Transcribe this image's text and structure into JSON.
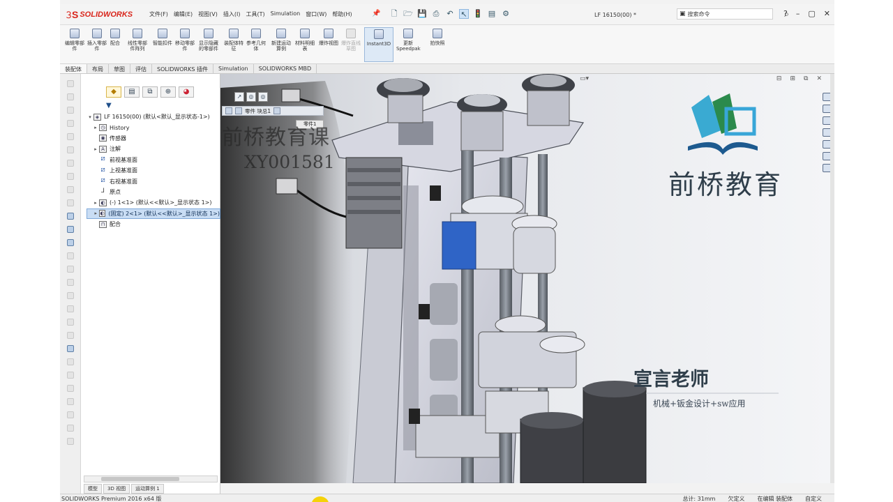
{
  "app": {
    "brand_logo": "SOLIDWORKS",
    "document_title": "LF 16150(00) *",
    "menus": [
      "文件(F)",
      "编辑(E)",
      "视图(V)",
      "插入(I)",
      "工具(T)",
      "Simulation",
      "窗口(W)",
      "帮助(H)"
    ],
    "search_placeholder": "搜索命令",
    "window_buttons": [
      "?",
      "–",
      "▢",
      "✕"
    ]
  },
  "commands": [
    {
      "label": "编辑零部件",
      "icon": "edit-component-icon",
      "state": "enabled"
    },
    {
      "label": "插入零部件",
      "icon": "insert-components-icon",
      "state": "enabled"
    },
    {
      "label": "配合",
      "icon": "mate-icon",
      "state": "enabled"
    },
    {
      "label": "线性零部件阵列",
      "icon": "linear-pattern-icon",
      "state": "enabled"
    },
    {
      "label": "智能扣件",
      "icon": "smart-fasteners-icon",
      "state": "enabled"
    },
    {
      "label": "移动零部件",
      "icon": "move-component-icon",
      "state": "enabled"
    },
    {
      "label": "显示隐藏的零部件",
      "icon": "show-hidden-icon",
      "state": "enabled"
    },
    {
      "label": "装配体特征",
      "icon": "assembly-features-icon",
      "state": "enabled"
    },
    {
      "label": "参考几何体",
      "icon": "reference-geometry-icon",
      "state": "enabled"
    },
    {
      "label": "新建运动算例",
      "icon": "motion-study-icon",
      "state": "enabled"
    },
    {
      "label": "材料明细表",
      "icon": "bom-icon",
      "state": "enabled"
    },
    {
      "label": "爆炸视图",
      "icon": "exploded-view-icon",
      "state": "enabled"
    },
    {
      "label": "爆炸直线草图",
      "icon": "explode-line-sketch-icon",
      "state": "disabled"
    },
    {
      "label": "Instant3D",
      "icon": "instant3d-icon",
      "state": "active"
    },
    {
      "label": "更新Speedpak",
      "icon": "speedpak-icon",
      "state": "enabled"
    },
    {
      "label": "拍快照",
      "icon": "snapshot-icon",
      "state": "enabled"
    }
  ],
  "tabs": [
    {
      "label": "装配体",
      "active": true
    },
    {
      "label": "布局",
      "active": false
    },
    {
      "label": "草图",
      "active": false
    },
    {
      "label": "评估",
      "active": false
    },
    {
      "label": "SOLIDWORKS 插件",
      "active": false
    },
    {
      "label": "Simulation",
      "active": false
    },
    {
      "label": "SOLIDWORKS MBD",
      "active": false
    }
  ],
  "feature_tree": {
    "root": "LF 16150(00)  (默认<默认_显示状态-1>)",
    "items": [
      {
        "label": "History",
        "icon": "history-icon",
        "expandable": true
      },
      {
        "label": "传感器",
        "icon": "sensor-icon",
        "expandable": false
      },
      {
        "label": "注解",
        "icon": "annotations-icon",
        "expandable": true
      },
      {
        "label": "前视基准面",
        "icon": "plane-icon",
        "expandable": false
      },
      {
        "label": "上视基准面",
        "icon": "plane-icon",
        "expandable": false
      },
      {
        "label": "右视基准面",
        "icon": "plane-icon",
        "expandable": false
      },
      {
        "label": "原点",
        "icon": "origin-icon",
        "expandable": false
      },
      {
        "label": "(-) 1<1> (默认<<默认>_显示状态 1>)",
        "icon": "part-icon",
        "expandable": true
      },
      {
        "label": "(固定) 2<1> (默认<<默认>_显示状态 1>)",
        "icon": "part-icon",
        "expandable": true,
        "selected": true
      },
      {
        "label": "配合",
        "icon": "mates-icon",
        "expandable": false
      }
    ],
    "bottom_tabs": [
      "模型",
      "3D 视图",
      "运动算例 1"
    ]
  },
  "viewport": {
    "flyout_label": "零件 块总1",
    "flyout_sub": "零件1",
    "watermark_course": "前桥教育课",
    "watermark_code": "XY001581",
    "brand_name": "前桥教育",
    "teacher": "宣言老师",
    "teacher_subtitle": "机械+钣金设计+sw应用"
  },
  "statusbar": {
    "left": "SOLIDWORKS Premium 2016 x64 版",
    "right": [
      "总计: 31mm",
      "欠定义",
      "在编辑 装配体",
      "自定义"
    ]
  },
  "colors": {
    "brand": "#d9261c",
    "selection": "#c9ddf4",
    "accent": "#1a5fb4"
  }
}
